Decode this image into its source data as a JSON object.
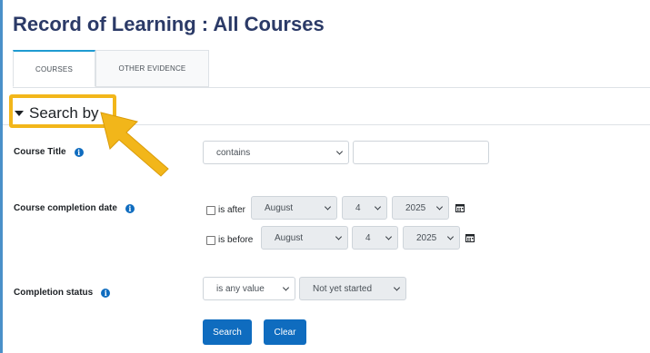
{
  "page": {
    "title": "Record of Learning : All Courses"
  },
  "tabs": [
    {
      "label": "COURSES",
      "active": true
    },
    {
      "label": "OTHER EVIDENCE",
      "active": false
    }
  ],
  "search": {
    "header": "Search by",
    "course_title": {
      "label": "Course Title",
      "operator": "contains",
      "value": ""
    },
    "completion_date": {
      "label": "Course completion date",
      "after": {
        "label": "is after",
        "checked": false,
        "month": "August",
        "day": "4",
        "year": "2025"
      },
      "before": {
        "label": "is before",
        "checked": false,
        "month": "August",
        "day": "4",
        "year": "2025"
      }
    },
    "completion_status": {
      "label": "Completion status",
      "operator": "is any value",
      "value": "Not yet started"
    },
    "buttons": {
      "search": "Search",
      "clear": "Clear"
    }
  },
  "annotation": {
    "highlight_color": "#f2b61a"
  },
  "colors": {
    "primary": "#0f6cbf",
    "title": "#2b3a67",
    "tab_accent": "#1f9bd1"
  },
  "icons": {
    "info": "i"
  }
}
